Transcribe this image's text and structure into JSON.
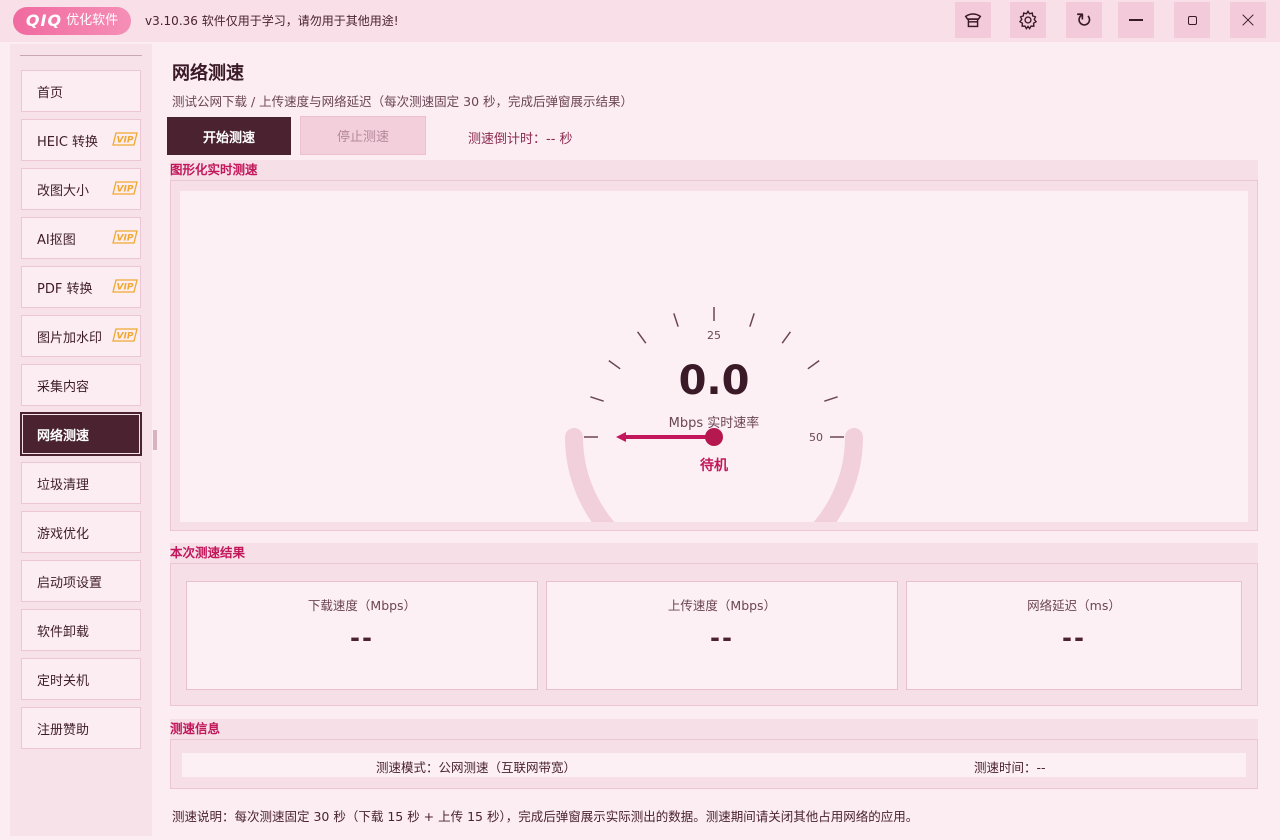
{
  "app": {
    "brand": "QIQ",
    "brand_name": "优化软件",
    "version_text": "v3.10.36 软件仅用于学习，请勿用于其他用途!"
  },
  "window_controls": {
    "icons": [
      "hat-icon",
      "gear-icon",
      "refresh-icon",
      "minimize-icon",
      "maximize-icon",
      "close-icon"
    ]
  },
  "sidebar": {
    "items": [
      {
        "label": "首页",
        "vip": false,
        "active": false
      },
      {
        "label": "HEIC 转换",
        "vip": true,
        "active": false
      },
      {
        "label": "改图大小",
        "vip": true,
        "active": false
      },
      {
        "label": "AI抠图",
        "vip": true,
        "active": false
      },
      {
        "label": "PDF 转换",
        "vip": true,
        "active": false
      },
      {
        "label": "图片加水印",
        "vip": true,
        "active": false
      },
      {
        "label": "采集内容",
        "vip": false,
        "active": false
      },
      {
        "label": "网络测速",
        "vip": false,
        "active": true
      },
      {
        "label": "垃圾清理",
        "vip": false,
        "active": false
      },
      {
        "label": "游戏优化",
        "vip": false,
        "active": false
      },
      {
        "label": "启动项设置",
        "vip": false,
        "active": false
      },
      {
        "label": "软件卸载",
        "vip": false,
        "active": false
      },
      {
        "label": "定时关机",
        "vip": false,
        "active": false
      },
      {
        "label": "注册赞助",
        "vip": false,
        "active": false
      }
    ],
    "vip_badge": "VIP"
  },
  "main": {
    "title": "网络测速",
    "subtitle": "测试公网下载 / 上传速度与网络延迟（每次测速固定 30 秒，完成后弹窗展示结果）",
    "start_button": "开始测速",
    "stop_button": "停止测速",
    "countdown": "测速倒计时：-- 秒"
  },
  "gauge_section": {
    "header": "图形化实时测速",
    "value": "0.0",
    "unit_label": "Mbps 实时速率",
    "status": "待机",
    "scale_min": 0,
    "scale_max": 50,
    "tick_labels": [
      "25",
      "50"
    ],
    "current_value": 0,
    "accent_color": "#c2185b"
  },
  "results_section": {
    "header": "本次测速结果",
    "cards": [
      {
        "label": "下载速度（Mbps）",
        "value": "--"
      },
      {
        "label": "上传速度（Mbps）",
        "value": "--"
      },
      {
        "label": "网络延迟（ms）",
        "value": "--"
      }
    ]
  },
  "info_section": {
    "header": "测速信息",
    "mode": "测速模式：公网测速（互联网带宽）",
    "time": "测速时间：--"
  },
  "footer_note": "测速说明：每次测速固定 30 秒（下载 15 秒 + 上传 15 秒），完成后弹窗展示实际测出的数据。测速期间请关闭其他占用网络的应用。"
}
